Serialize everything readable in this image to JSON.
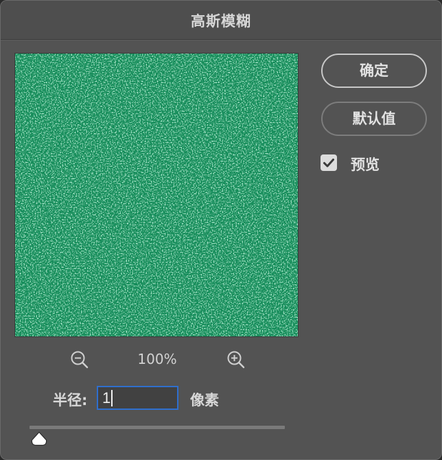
{
  "dialog": {
    "title": "高斯模糊"
  },
  "preview": {
    "base_color": "#118a55"
  },
  "zoom": {
    "level": "100%",
    "zoom_out_icon": "zoom-out-icon",
    "zoom_in_icon": "zoom-in-icon"
  },
  "buttons": {
    "ok_label": "确定",
    "defaults_label": "默认值"
  },
  "preview_toggle": {
    "label": "预览",
    "checked": true
  },
  "radius": {
    "label": "半径:",
    "value": "1",
    "unit": "像素",
    "slider_value_fraction": 0.0
  },
  "colors": {
    "dialog_bg": "#535353",
    "focus_border": "#2f6fce",
    "text": "#e2e2e2"
  }
}
